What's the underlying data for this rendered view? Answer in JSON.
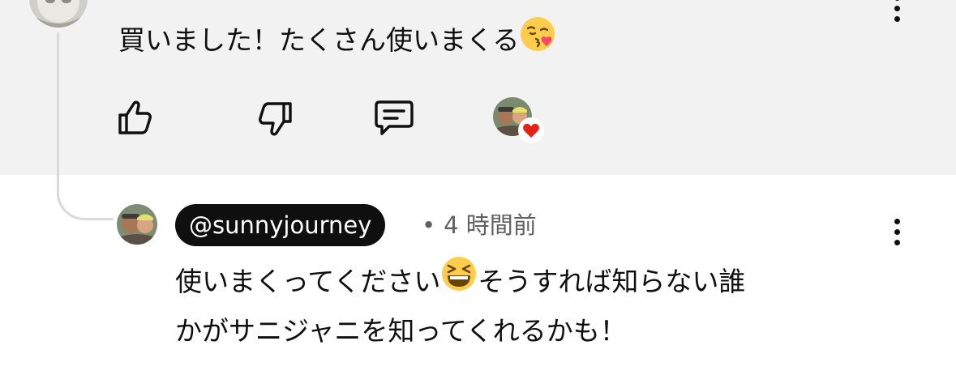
{
  "parent_comment": {
    "text": "買いました！たくさん使いまくる",
    "emoji": "face-blowing-kiss-emoji",
    "actions": {
      "like_icon": "thumbs-up-icon",
      "dislike_icon": "thumbs-down-icon",
      "reply_icon": "comment-icon",
      "creator_heart_icon": "heart-icon"
    }
  },
  "reply": {
    "author": "@sunnyjourney",
    "separator": "•",
    "timestamp": "4 時間前",
    "text_line1_part1": "使いまくってください",
    "emoji": "grinning-squinting-face-emoji",
    "text_line1_part2": "そうすれば知らない誰",
    "text_line2": "かがサニジャニを知ってくれるかも！"
  },
  "colors": {
    "highlight_bg": "#f2f2f2",
    "text": "#0f0f0f",
    "meta_text": "#606060",
    "author_chip_bg": "#0f0f0f",
    "heart": "#e62117"
  }
}
